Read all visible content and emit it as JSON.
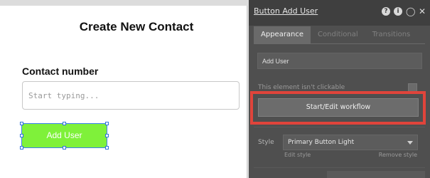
{
  "canvas": {
    "title": "Create New Contact",
    "field_label": "Contact number",
    "input_placeholder": "Start typing...",
    "input_value": "",
    "button_label": "Add User",
    "button_color": "#7ff13a",
    "selection_color": "#3b7ef0"
  },
  "editor": {
    "title": "Button Add User",
    "header_icons": [
      "help-icon",
      "info-icon",
      "comment-icon",
      "close-icon"
    ],
    "tabs": [
      {
        "label": "Appearance",
        "active": true
      },
      {
        "label": "Conditional",
        "active": false
      },
      {
        "label": "Transitions",
        "active": false
      }
    ],
    "element_name": "Add User",
    "not_clickable_label": "This element isn't clickable",
    "not_clickable_checked": false,
    "workflow_button": "Start/Edit workflow",
    "highlight_color": "#e0443b",
    "style_label": "Style",
    "style_value": "Primary Button Light",
    "edit_style": "Edit style",
    "remove_style": "Remove style"
  }
}
